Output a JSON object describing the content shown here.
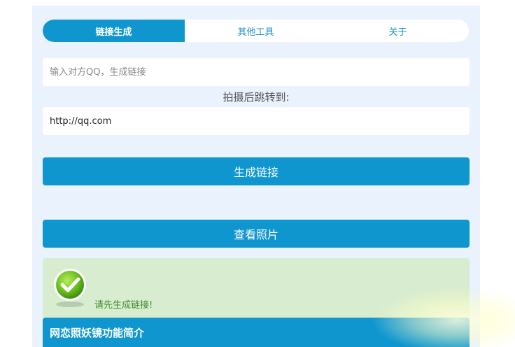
{
  "tabs": [
    {
      "label": "链接生成",
      "active": true
    },
    {
      "label": "其他工具",
      "active": false
    },
    {
      "label": "关于",
      "active": false
    }
  ],
  "qq_input": {
    "placeholder": "输入对方QQ，生成链接",
    "value": ""
  },
  "redirect": {
    "label": "拍摄后跳转到:",
    "value": "http://qq.com"
  },
  "buttons": {
    "generate": "生成链接",
    "view_photos": "查看照片"
  },
  "alert": {
    "icon": "check-icon",
    "text": "请先生成链接!"
  },
  "intro": {
    "title": "网恋照妖镜功能简介"
  },
  "colors": {
    "accent": "#0f96cf",
    "panel_bg": "#e9f2fd",
    "success_bg": "#d8eccf",
    "success_text": "#3f8c2a"
  }
}
